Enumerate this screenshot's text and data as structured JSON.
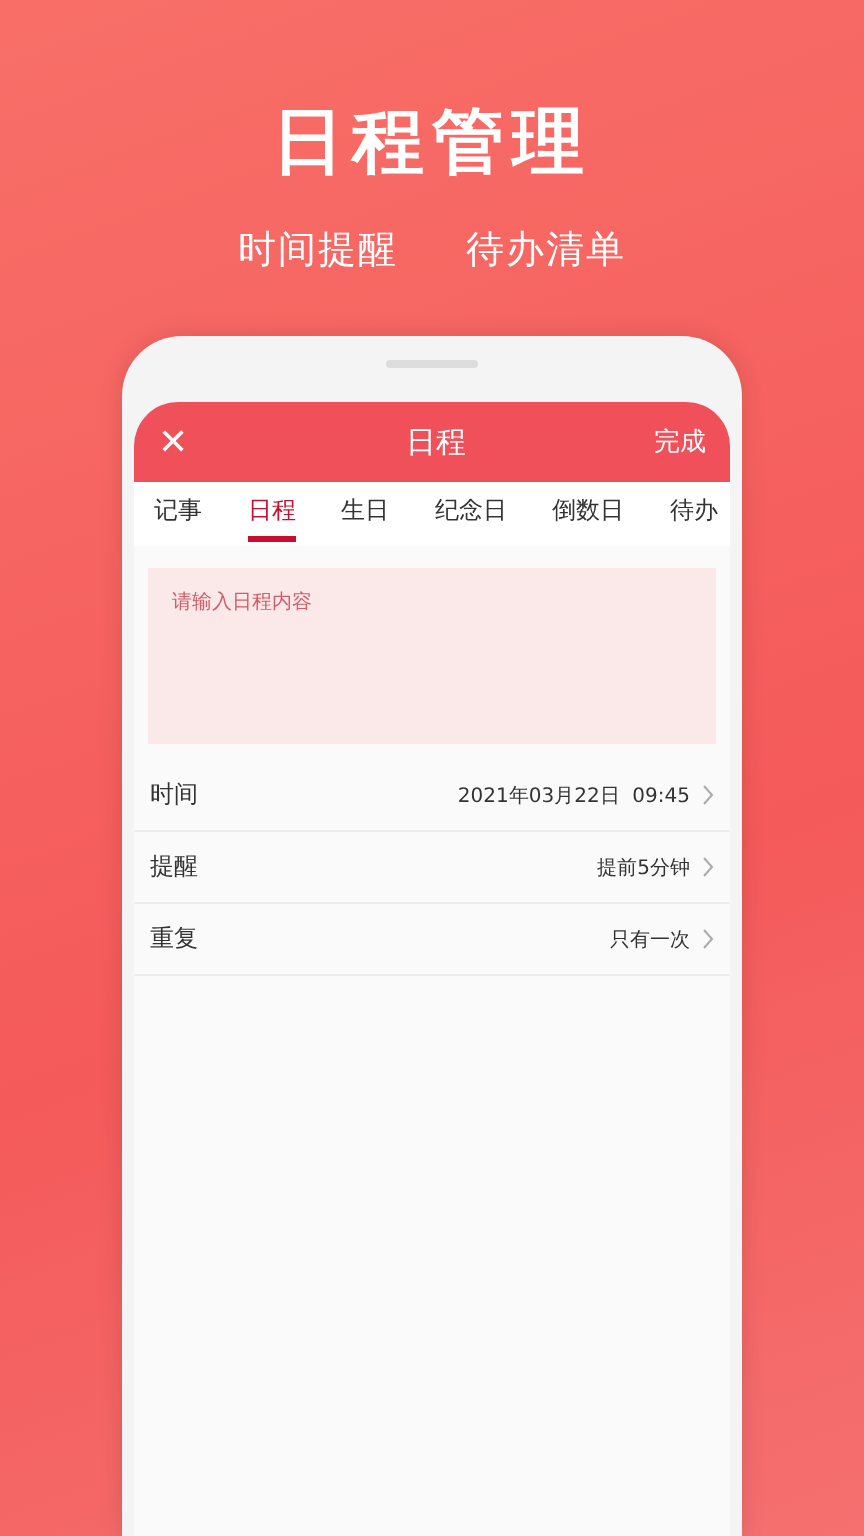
{
  "headline": "日程管理",
  "taglines": [
    "时间提醒",
    "待办清单"
  ],
  "header": {
    "close": "✕",
    "title": "日程",
    "done": "完成"
  },
  "tabs": [
    {
      "label": "记事",
      "selected": false
    },
    {
      "label": "日程",
      "selected": true
    },
    {
      "label": "生日",
      "selected": false
    },
    {
      "label": "纪念日",
      "selected": false
    },
    {
      "label": "倒数日",
      "selected": false
    },
    {
      "label": "待办",
      "selected": false
    }
  ],
  "input": {
    "placeholder": "请输入日程内容"
  },
  "settings": [
    {
      "label": "时间",
      "value": "2021年03月22日  09:45"
    },
    {
      "label": "提醒",
      "value": "提前5分钟"
    },
    {
      "label": "重复",
      "value": "只有一次"
    }
  ]
}
